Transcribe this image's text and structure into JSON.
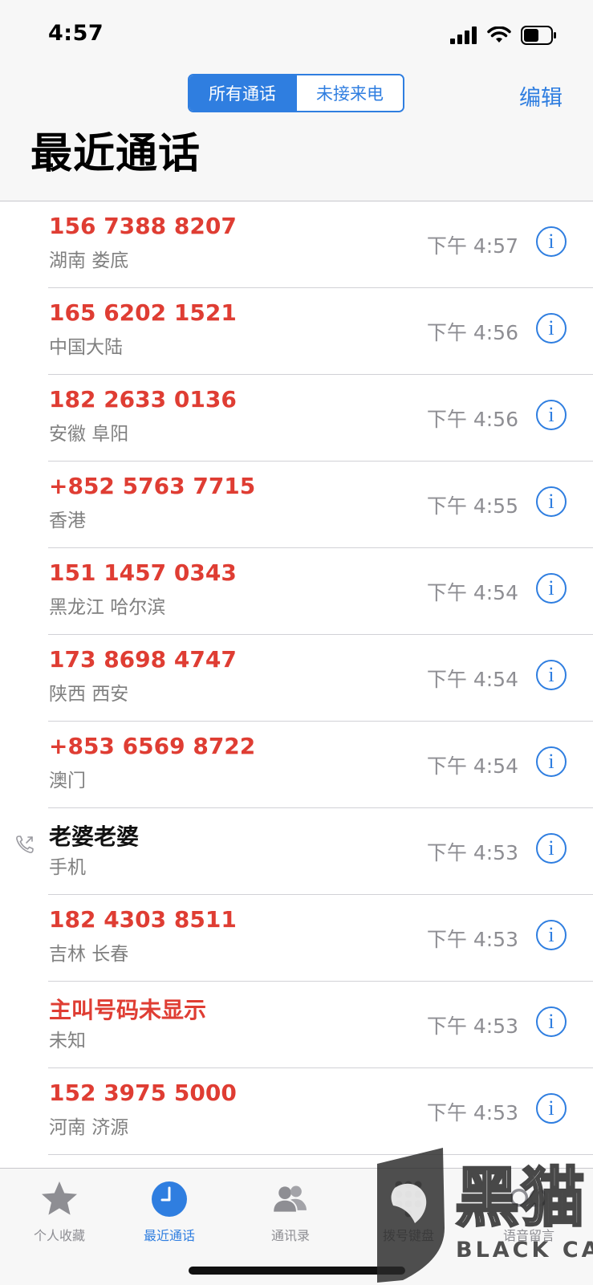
{
  "status_bar": {
    "time": "4:57",
    "icons": [
      "signal-icon",
      "wifi-icon",
      "battery-icon"
    ]
  },
  "header": {
    "segments": [
      {
        "label": "所有通话",
        "selected": true
      },
      {
        "label": "未接来电",
        "selected": false
      }
    ],
    "edit_label": "编辑",
    "title": "最近通话"
  },
  "colors": {
    "accent": "#2f7ee0",
    "missed": "#df3d33",
    "secondary_text": "#8e8e93"
  },
  "calls": [
    {
      "name": "156 7388 8207",
      "location": "湖南 娄底",
      "time": "下午 4:57",
      "missed": true,
      "outgoing": false
    },
    {
      "name": "165 6202 1521",
      "location": "中国大陆",
      "time": "下午 4:56",
      "missed": true,
      "outgoing": false
    },
    {
      "name": "182 2633 0136",
      "location": "安徽 阜阳",
      "time": "下午 4:56",
      "missed": true,
      "outgoing": false
    },
    {
      "name": "+852 5763 7715",
      "location": "香港",
      "time": "下午 4:55",
      "missed": true,
      "outgoing": false
    },
    {
      "name": "151 1457 0343",
      "location": "黑龙江 哈尔滨",
      "time": "下午 4:54",
      "missed": true,
      "outgoing": false
    },
    {
      "name": "173 8698 4747",
      "location": "陕西 西安",
      "time": "下午 4:54",
      "missed": true,
      "outgoing": false
    },
    {
      "name": "+853 6569 8722",
      "location": "澳门",
      "time": "下午 4:54",
      "missed": true,
      "outgoing": false
    },
    {
      "name": "老婆老婆",
      "location": "手机",
      "time": "下午 4:53",
      "missed": false,
      "outgoing": true
    },
    {
      "name": "182 4303 8511",
      "location": "吉林 长春",
      "time": "下午 4:53",
      "missed": true,
      "outgoing": false
    },
    {
      "name": "主叫号码未显示",
      "location": "未知",
      "time": "下午 4:53",
      "missed": true,
      "outgoing": false
    },
    {
      "name": "152 3975 5000",
      "location": "河南 济源",
      "time": "下午 4:53",
      "missed": true,
      "outgoing": false
    },
    {
      "name": "",
      "location": "",
      "time": "",
      "missed": true,
      "outgoing": false
    }
  ],
  "tab_bar": {
    "tabs": [
      {
        "label": "个人收藏",
        "icon": "star-icon",
        "active": false
      },
      {
        "label": "最近通话",
        "icon": "clock-icon",
        "active": true
      },
      {
        "label": "通讯录",
        "icon": "contacts-icon",
        "active": false
      },
      {
        "label": "拨号键盘",
        "icon": "keypad-icon",
        "active": false
      },
      {
        "label": "语音留言",
        "icon": "voicemail-icon",
        "active": false
      }
    ]
  },
  "watermark": {
    "text": "黑猫",
    "subtext": "BLACK CAT"
  }
}
